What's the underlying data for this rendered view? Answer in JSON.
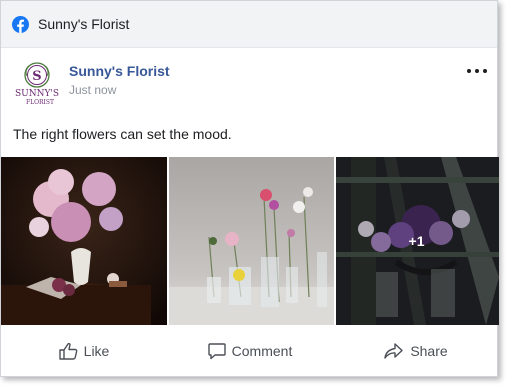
{
  "topbar": {
    "title": "Sunny's Florist",
    "icon": "facebook-icon"
  },
  "post": {
    "page_name": "Sunny's Florist",
    "time": "Just now",
    "text": "The right flowers can set the mood.",
    "avatar_logo": {
      "initial": "S",
      "line1": "SUNNY'S",
      "line2": "FLORIST"
    },
    "photos": [
      {
        "name": "hydrangea-bouquet-photo"
      },
      {
        "name": "glass-vases-photo"
      },
      {
        "name": "purple-roses-photo",
        "overlay": "+1"
      }
    ]
  },
  "actions": {
    "like": "Like",
    "comment": "Comment",
    "share": "Share"
  },
  "colors": {
    "brand_blue": "#1877f2",
    "link_blue": "#385898",
    "logo_purple": "#6d2a73",
    "logo_green": "#4c7a3a"
  }
}
